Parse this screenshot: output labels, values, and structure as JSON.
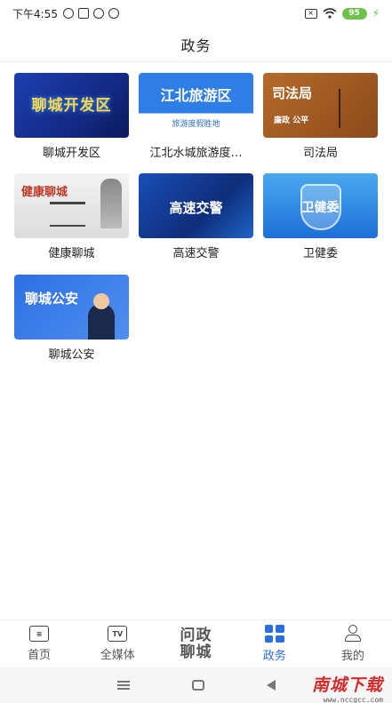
{
  "status_bar": {
    "time": "下午4:55",
    "battery": "95",
    "icons": [
      "hotspot-icon",
      "sync-icon",
      "location-icon",
      "nfc-icon",
      "sim-off-icon",
      "wifi-icon",
      "charging-icon"
    ]
  },
  "header": {
    "title": "政务"
  },
  "tiles": [
    {
      "label": "聊城开发区",
      "image_text": "聊城开发区"
    },
    {
      "label": "江北水城旅游度…",
      "image_text": "江北旅游区",
      "image_subtext": "旅游度假胜地"
    },
    {
      "label": "司法局",
      "image_text": "司法局",
      "image_subtext": "廉政 公平"
    },
    {
      "label": "健康聊城",
      "image_text": "健康聊城"
    },
    {
      "label": "高速交警",
      "image_text": "高速交警"
    },
    {
      "label": "卫健委",
      "image_text": "卫健委"
    },
    {
      "label": "聊城公安",
      "image_text": "聊城公安"
    }
  ],
  "bottom_nav": {
    "items": [
      {
        "label": "首页",
        "icon": "news-icon"
      },
      {
        "label": "全媒体",
        "icon": "tv-icon",
        "icon_text": "TV"
      },
      {
        "label": "问政聊城",
        "line1": "问政",
        "line2": "聊城"
      },
      {
        "label": "政务",
        "icon": "grid-icon",
        "active": true
      },
      {
        "label": "我的",
        "icon": "person-icon"
      }
    ],
    "active_color": "#2b6fdc"
  },
  "watermark": {
    "main": "南城下载",
    "sub": "www.nccgcc.com"
  }
}
